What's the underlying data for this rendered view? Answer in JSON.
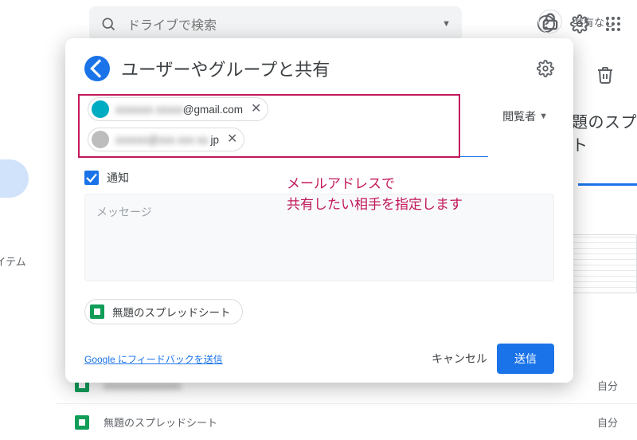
{
  "search": {
    "placeholder": "ドライブで検索"
  },
  "dialog": {
    "title": "ユーザーやグループと共有",
    "role_label": "閲覧者",
    "recipients": [
      {
        "masked_prefix": "xxxxxxx  xxxxx",
        "suffix": "@gmail.com",
        "avatar_color": "#00acc1"
      },
      {
        "masked_prefix": "xxxxxx@",
        "suffix": "jp",
        "mid_mask": "xxx  xxx  xx.",
        "avatar_color": "#bdbdbd"
      }
    ],
    "notify_label": "通知",
    "notify_checked": true,
    "message_placeholder": "メッセージ",
    "attachment": "無題のスプレッドシート",
    "feedback": "Google にフィードバックを送信",
    "cancel": "キャンセル",
    "send": "送信"
  },
  "annotation": {
    "line1": "メールアドレスで",
    "line2": "共有したい相手を指定します"
  },
  "background": {
    "right_title_a": "題のスプ",
    "right_title_b": "ト",
    "sidebar_item": "アイテム",
    "row_title": "無題のスプレッドシート",
    "row_title_masked": "xxxxxxxxxxxxxxx",
    "row_owner": "自分",
    "share_status": "共有なし"
  }
}
